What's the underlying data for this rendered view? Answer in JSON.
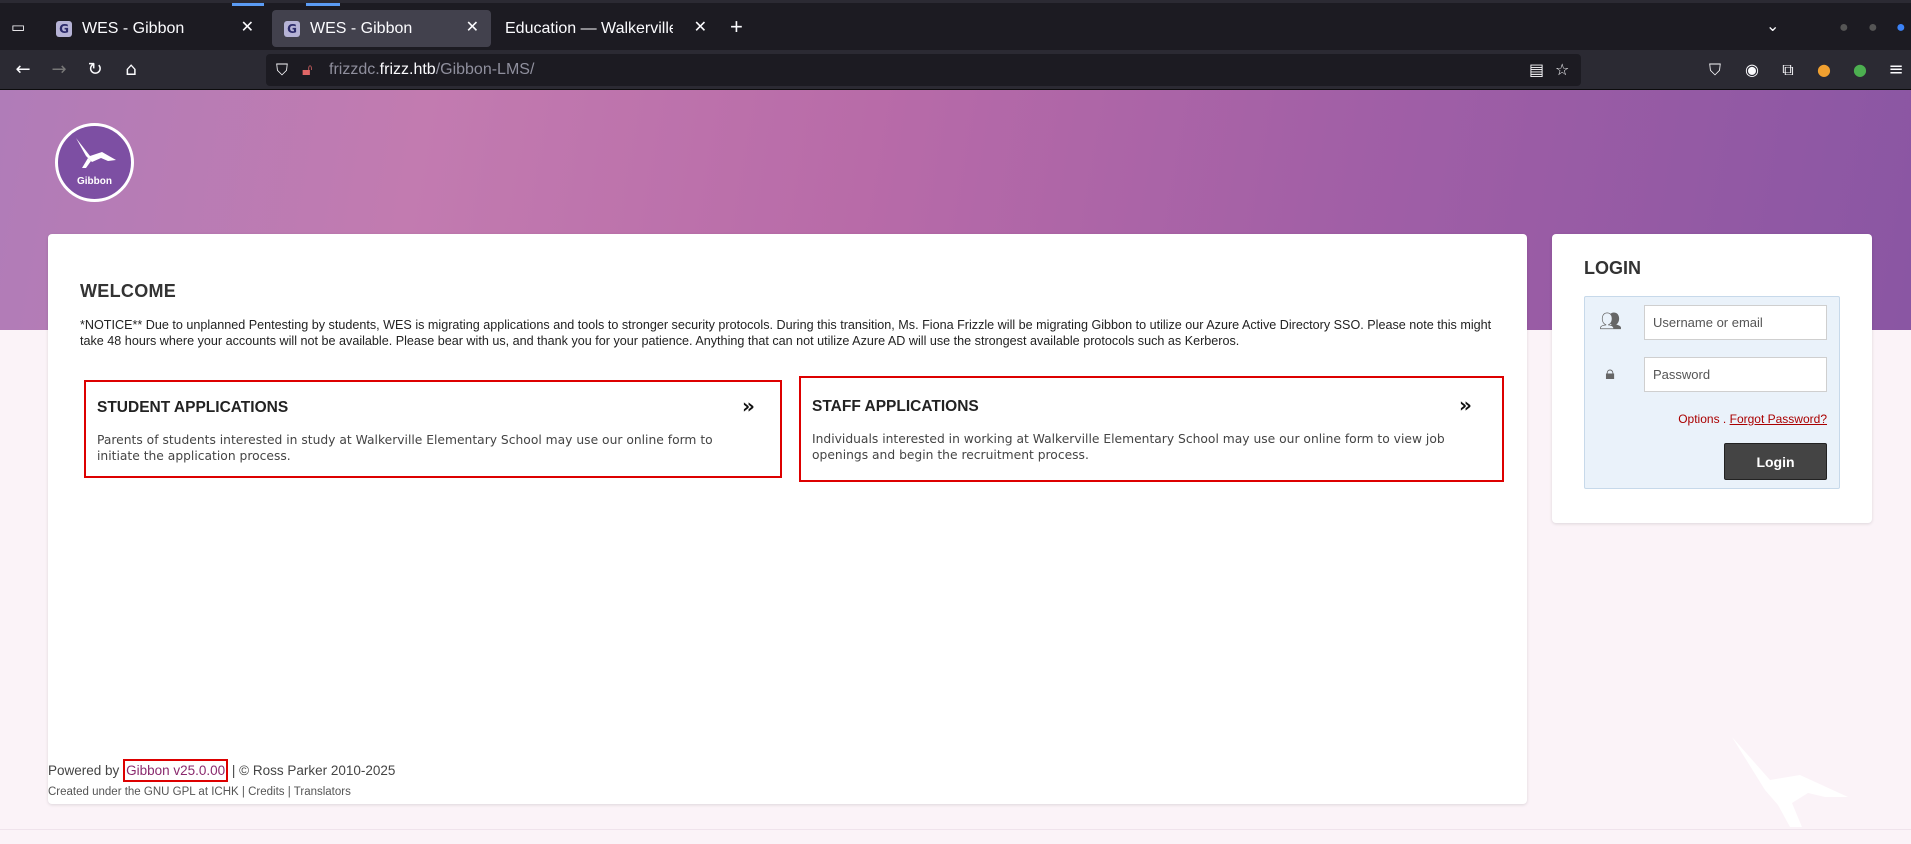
{
  "browser": {
    "tabs": [
      {
        "title": "WES - Gibbon",
        "active": false
      },
      {
        "title": "WES - Gibbon",
        "active": true
      },
      {
        "title": "Education — Walkerville Elem",
        "active": false
      }
    ],
    "url_prefix": "frizzdc.",
    "url_host": "frizz.htb",
    "url_path": "/Gibbon-LMS/",
    "accent_color": "#5b9cf5"
  },
  "header": {
    "logo_text": "Gibbon"
  },
  "welcome": {
    "title": "WELCOME",
    "notice": "*NOTICE** Due to unplanned Pentesting by students, WES is migrating applications and tools to stronger security protocols. During this transition, Ms. Fiona Frizzle will be migrating Gibbon to utilize our Azure Active Directory SSO. Please note this might take 48 hours where your accounts will not be available. Please bear with us, and thank you for your patience. Anything that can not utilize Azure AD will use the strongest available protocols such as Kerberos."
  },
  "applications": {
    "student": {
      "title": "STUDENT APPLICATIONS",
      "description": "Parents of students interested in study at Walkerville Elementary School may use our online form to initiate the application process."
    },
    "staff": {
      "title": "STAFF APPLICATIONS",
      "description": "Individuals interested in working at Walkerville Elementary School may use our online form to view job openings and begin the recruitment process."
    },
    "chevron": "»",
    "highlight_color": "#dd0000"
  },
  "login": {
    "title": "LOGIN",
    "username_placeholder": "Username or email",
    "password_placeholder": "Password",
    "options_label": "Options",
    "separator": ".",
    "forgot_label": "Forgot Password?",
    "button_label": "Login"
  },
  "footer": {
    "powered_by": "Powered by",
    "version": "Gibbon v25.0.00",
    "copyright": "| © Ross Parker 2010-2025",
    "gpl_text": "Created under the GNU GPL at",
    "ichk": "ICHK",
    "sep": "|",
    "credits": "Credits",
    "translators": "Translators"
  }
}
